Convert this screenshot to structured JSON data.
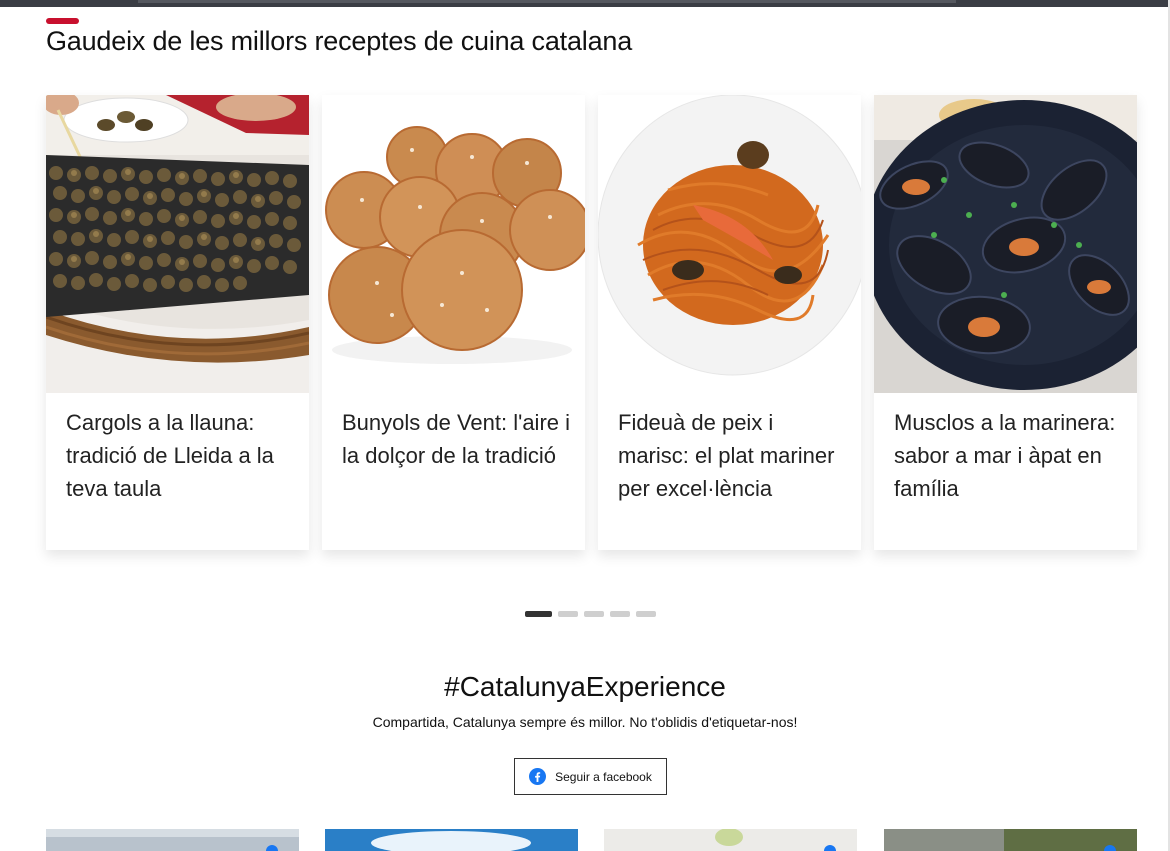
{
  "recipes": {
    "heading": "Gaudeix de les millors receptes de cuina catalana",
    "cards": [
      {
        "title": "Cargols a la llauna: tradició de Lleida a la teva taula",
        "image_icon": "snails-photo"
      },
      {
        "title": "Bunyols de Vent: l'aire i la dolçor de la tradició",
        "image_icon": "fritters-photo"
      },
      {
        "title": "Fideuà de peix i marisc: el plat mariner per excel·lència",
        "image_icon": "fideua-photo"
      },
      {
        "title": "Musclos a la marinera: sabor a mar i àpat en família",
        "image_icon": "mussels-photo"
      }
    ],
    "carousel": {
      "total_pages": 5,
      "active_page": 1
    }
  },
  "social": {
    "hashtag": "#CatalunyaExperience",
    "subtitle": "Compartida, Catalunya sempre és millor. No t'oblidis d'etiquetar-nos!",
    "follow_button_label": "Seguir a facebook",
    "follow_icon": "facebook-icon"
  },
  "colors": {
    "accent": "#c8102e",
    "facebook": "#1877f2",
    "dot_active": "#333333",
    "dot_inactive": "#cfcfcf"
  }
}
